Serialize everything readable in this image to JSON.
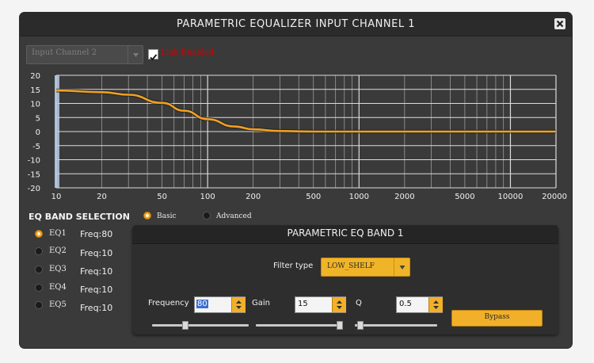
{
  "window": {
    "title": "PARAMETRIC EQUALIZER INPUT CHANNEL 1"
  },
  "channel_select": {
    "value": "Input Channel 2"
  },
  "link": {
    "label": "Link Enabled",
    "checked": true
  },
  "chart_data": {
    "type": "line",
    "y_ticks": [
      "20",
      "15",
      "10",
      "5",
      "0",
      "-5",
      "-10",
      "-15",
      "-20"
    ],
    "x_ticks": [
      "10",
      "20",
      "50",
      "100",
      "200",
      "500",
      "1000",
      "2000",
      "5000",
      "10000",
      "20000"
    ],
    "xscale": "log",
    "xlim": [
      10,
      20000
    ],
    "ylim": [
      -20,
      20
    ],
    "grid": true,
    "series": [
      {
        "x": [
          10,
          20,
          30,
          50,
          70,
          100,
          150,
          200,
          300,
          500,
          1000,
          20000
        ],
        "y": [
          14.6,
          14.0,
          13.1,
          10.2,
          7.4,
          4.4,
          1.8,
          0.8,
          0.2,
          0.0,
          0.0,
          0.0
        ],
        "color": "#f0a020"
      }
    ]
  },
  "eq_band_selection": {
    "title": "EQ BAND SELECTION",
    "modes": [
      {
        "label": "Basic",
        "selected": true
      },
      {
        "label": "Advanced",
        "selected": false
      }
    ],
    "bands": [
      {
        "name": "EQ1",
        "freq": "Freq:80",
        "selected": true
      },
      {
        "name": "EQ2",
        "freq": "Freq:10",
        "selected": false
      },
      {
        "name": "EQ3",
        "freq": "Freq:10",
        "selected": false
      },
      {
        "name": "EQ4",
        "freq": "Freq:10",
        "selected": false
      },
      {
        "name": "EQ5",
        "freq": "Freq:10",
        "selected": false
      }
    ]
  },
  "band_panel": {
    "title": "PARAMETRIC EQ BAND 1",
    "filter_type_label": "Filter type",
    "filter_type": "LOW_SHELF",
    "frequency_label": "Frequency",
    "frequency": "80",
    "gain_label": "Gain",
    "gain": "15",
    "q_label": "Q",
    "q": "0.5",
    "bypass_label": "Bypass",
    "sliders": {
      "frequency_level": 0.33,
      "gain_level": 1.0,
      "q_level": 0.03
    }
  },
  "colors": {
    "curve": "#f0a020",
    "accent": "#f2b02a",
    "link_label": "#d60000"
  }
}
